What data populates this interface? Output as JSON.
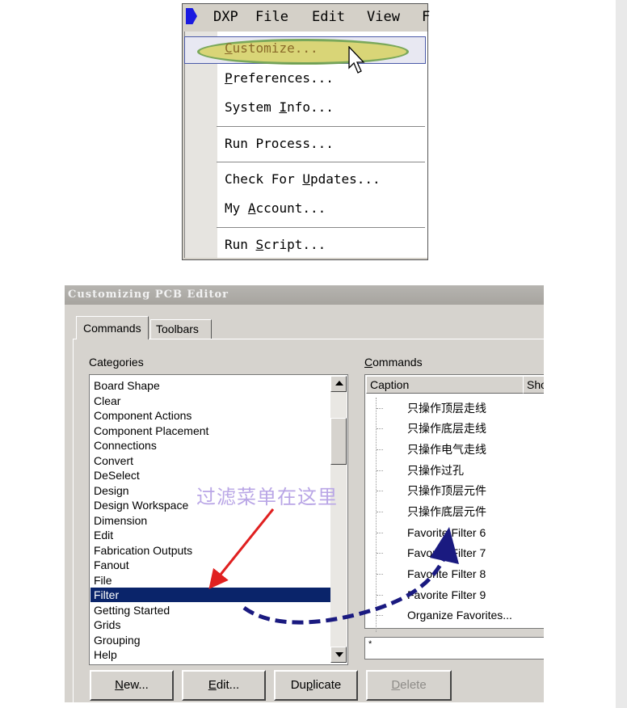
{
  "menubar": {
    "items": [
      {
        "label": "DXP",
        "underline": "X"
      },
      {
        "label": "File",
        "underline": "F"
      },
      {
        "label": "Edit",
        "underline": "E"
      },
      {
        "label": "View",
        "underline": "V"
      },
      {
        "label": "F"
      }
    ]
  },
  "dxp_menu": {
    "items": [
      {
        "pre": "",
        "u": "C",
        "post": "ustomize..."
      },
      {
        "pre": "",
        "u": "P",
        "post": "references..."
      },
      {
        "pre": "System ",
        "u": "I",
        "post": "nfo..."
      },
      {
        "pre": "Run Process...",
        "u": "",
        "post": ""
      },
      {
        "pre": "Check For ",
        "u": "U",
        "post": "pdates..."
      },
      {
        "pre": "My ",
        "u": "A",
        "post": "ccount..."
      },
      {
        "pre": "Run ",
        "u": "S",
        "post": "cript..."
      }
    ],
    "highlight_color": "#d8d36a"
  },
  "dialog": {
    "title": "Customizing PCB Editor",
    "tabs": [
      {
        "label": "Commands"
      },
      {
        "label": "Toolbars"
      }
    ],
    "categories_label": {
      "pre": "Cate",
      "u": "g",
      "post": "ories"
    },
    "commands_label": {
      "pre": "",
      "u": "C",
      "post": "ommands"
    },
    "categories": [
      "Board Shape",
      "Clear",
      "Component Actions",
      "Component Placement",
      "Connections",
      "Convert",
      "DeSelect",
      "Design",
      "Design Workspace",
      "Dimension",
      "Edit",
      "Fabrication Outputs",
      "Fanout",
      "File",
      "Filter",
      "Getting Started",
      "Grids",
      "Grouping",
      "Help"
    ],
    "selected_category": "Filter",
    "columns": {
      "caption": "Caption",
      "shortcut": "Sho"
    },
    "commands": [
      "只操作顶层走线",
      "只操作底层走线",
      "只操作电气走线",
      "只操作过孔",
      "只操作顶层元件",
      "只操作底层元件",
      "Favorite Filter 6",
      "Favorite Filter 7",
      "Favorite Filter 8",
      "Favorite Filter 9",
      "Organize Favorites..."
    ],
    "filter_value": "*",
    "buttons": {
      "new": {
        "pre": "",
        "u": "N",
        "post": "ew..."
      },
      "edit": {
        "pre": "",
        "u": "E",
        "post": "dit..."
      },
      "duplicate": {
        "pre": "Du",
        "u": "p",
        "post": "licate"
      },
      "delete": {
        "pre": "",
        "u": "D",
        "post": "elete"
      }
    }
  },
  "annotation": {
    "text": "过滤菜单在这里",
    "red_arrow_color": "#e02020",
    "blue_arrow_color": "#1a1a80"
  }
}
